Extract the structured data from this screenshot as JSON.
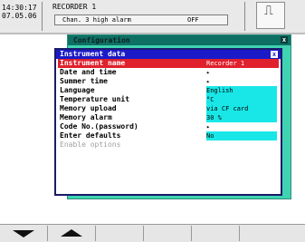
{
  "status": {
    "time": "14:30:17",
    "date": "07.05.06",
    "recorder_name": "RECORDER 1",
    "alarm_label": "Chan. 3 high alarm",
    "alarm_value": "OFF"
  },
  "config_window": {
    "title": "Configuration"
  },
  "instrument_window": {
    "title": "Instrument data",
    "rows": [
      {
        "label": "Instrument name",
        "value": "Recorder 1"
      },
      {
        "label": "Date and time",
        "value": "▸"
      },
      {
        "label": "Summer time",
        "value": "▸"
      },
      {
        "label": "Language",
        "value": "English"
      },
      {
        "label": "Temperature unit",
        "value": "°C"
      },
      {
        "label": "Memory upload",
        "value": "via CF card"
      },
      {
        "label": "Memory alarm",
        "value": "30 %"
      },
      {
        "label": "Code No.(password)",
        "value": "▸"
      },
      {
        "label": "Enter defaults",
        "value": "No"
      },
      {
        "label": "Enable options",
        "value": ""
      }
    ]
  },
  "icons": {
    "recorder": "recorder-icon"
  },
  "colors": {
    "title_bar": "#1a1ac8",
    "selected_row": "#e0202c",
    "value_highlight": "#19e7e7",
    "config_window": "#3fd3b2"
  }
}
